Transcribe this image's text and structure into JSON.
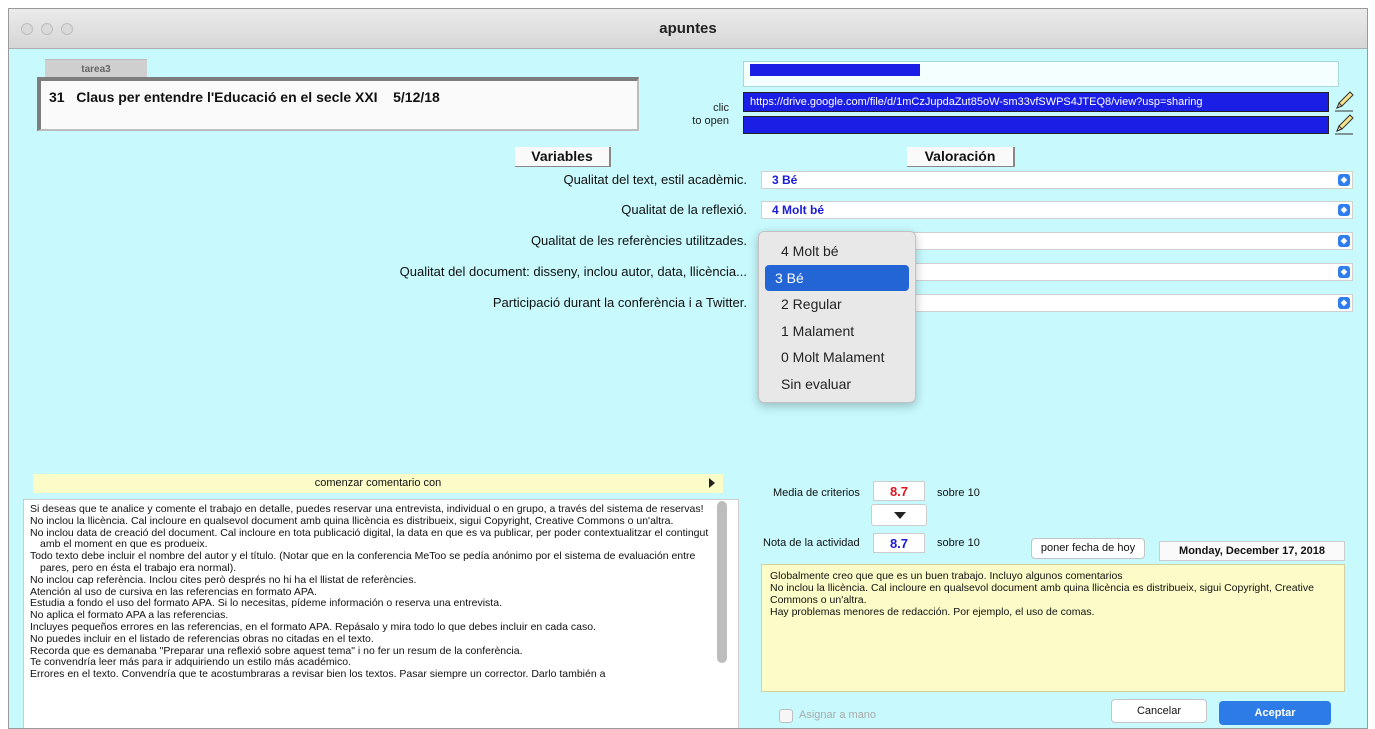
{
  "window": {
    "title": "apuntes"
  },
  "header": {
    "tab_label": "tarea3",
    "activity_title": "31   Claus per entendre l'Educació en el secle XXI    5/12/18",
    "clic_label_1": "clic",
    "clic_label_2": "to open",
    "url": "https://drive.google.com/file/d/1mCzJupdaZut85oW-sm33vfSWPS4JTEQ8/view?usp=sharing"
  },
  "columns": {
    "variables": "Variables",
    "valoracion": "Valoración"
  },
  "criteria": [
    {
      "label": "Qualitat del text, estil acadèmic.",
      "value": "3 Bé"
    },
    {
      "label": "Qualitat de la reflexió.",
      "value": "4 Molt bé"
    },
    {
      "label": "Qualitat de les referències utilitzades.",
      "value": ""
    },
    {
      "label": "Qualitat del document: disseny, inclou autor, data, llicència...",
      "value": ""
    },
    {
      "label": "Participació durant la conferència i a Twitter.",
      "value": ""
    }
  ],
  "dropdown": {
    "options": [
      "4 Molt bé",
      "3 Bé",
      "2 Regular",
      "1 Malament",
      "0 Molt Malament",
      "Sin evaluar"
    ],
    "selected": "3 Bé"
  },
  "comments": {
    "header": "comenzar comentario con",
    "lines": [
      "Si deseas que te analice y comente el trabajo en detalle, puedes reservar una entrevista, individual o en grupo, a través del sistema de reservas!",
      "No inclou la llicència. Cal incloure en qualsevol document amb quina llicència es distribueix, sigui Copyright, Creative Commons o un'altra.",
      "No inclou data de creació del document. Cal incloure en tota publicació digital, la data en que es va publicar, per poder contextualitzar el contingut amb el moment en que es produeix.",
      "Todo texto debe incluir el nombre del autor y el título. (Notar que en la conferencia MeToo se pedía anónimo por el sistema de evaluación entre pares, pero en ésta el trabajo era normal).",
      "No inclou cap referència. Inclou cites però després no hi ha el llistat de referències.",
      "Atención al uso de cursiva en las referencias en formato APA.",
      "Estudia a fondo el uso del formato APA. Si lo necesitas, pídeme información o reserva una entrevista.",
      "No aplica el formato APA a las referencias.",
      "Incluyes pequeños errores en las referencias, en el formato APA. Repásalo y mira todo lo que debes incluir en cada caso.",
      "No puedes incluir en el listado de referencias obras no citadas en el texto.",
      "Recorda que es demanaba \"Preparar una reflexió sobre aquest tema\" i no fer un resum de la conferència.",
      "Te convendría leer más para ir adquiriendo un estilo más académico.",
      "Errores en el texto. Convendría que te acostumbraras a revisar bien los textos. Pasar siempre un corrector. Darlo también a"
    ]
  },
  "grading": {
    "media_label": "Media de criterios",
    "media_value": "8.7",
    "media_sobre": "sobre  10",
    "nota_label": "Nota de la actividad",
    "nota_value": "8.7",
    "nota_sobre": "sobre  10",
    "today_button": "poner fecha de hoy",
    "date": "Monday, December 17, 2018",
    "summary_lines": [
      "Globalmente creo que que es un buen trabajo.  Incluyo algunos comentarios",
      "No inclou la llicència. Cal incloure en qualsevol document amb quina llicència es distribueix, sigui Copyright, Creative Commons o un'altra.",
      "Hay problemas menores de redacción. Por ejemplo, el uso de comas."
    ],
    "asignar_label": "Asignar a mano",
    "cancel_label": "Cancelar",
    "accept_label": "Aceptar"
  },
  "colors": {
    "background": "#c7f9fd",
    "url_field": "#1b1fe6",
    "accent_blue": "#2d7be6",
    "score_red": "#e0141e",
    "score_blue": "#1a1ad8",
    "note_yellow": "#fcfcc8"
  },
  "icons": [
    "pencil-icon",
    "select-arrow-icon",
    "disclosure-triangle-icon",
    "dropdown-triangle-icon"
  ]
}
